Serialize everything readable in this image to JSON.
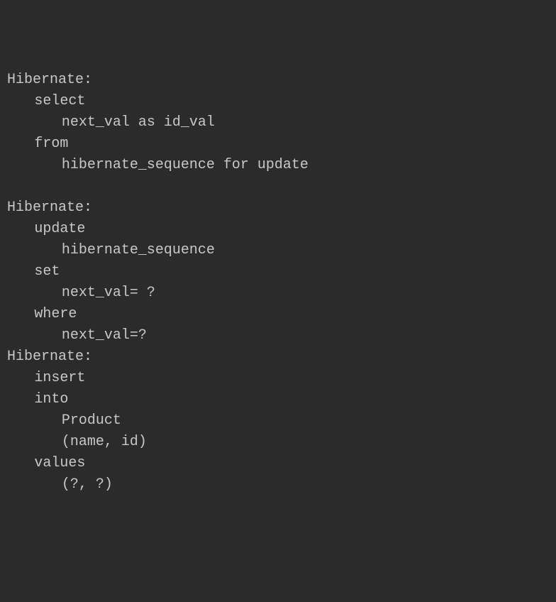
{
  "lines": [
    {
      "level": 0,
      "text": "Hibernate: "
    },
    {
      "level": 1,
      "text": "select"
    },
    {
      "level": 2,
      "text": "next_val as id_val "
    },
    {
      "level": 1,
      "text": "from"
    },
    {
      "level": 2,
      "text": "hibernate_sequence for update"
    },
    {
      "level": 0,
      "text": "            "
    },
    {
      "level": 0,
      "text": "Hibernate: "
    },
    {
      "level": 1,
      "text": "update"
    },
    {
      "level": 2,
      "text": "hibernate_sequence "
    },
    {
      "level": 1,
      "text": "set"
    },
    {
      "level": 2,
      "text": "next_val= ? "
    },
    {
      "level": 1,
      "text": "where"
    },
    {
      "level": 2,
      "text": "next_val=?"
    },
    {
      "level": 0,
      "text": "Hibernate: "
    },
    {
      "level": 1,
      "text": "insert "
    },
    {
      "level": 1,
      "text": "into"
    },
    {
      "level": 2,
      "text": "Product"
    },
    {
      "level": 2,
      "text": "(name, id) "
    },
    {
      "level": 1,
      "text": "values"
    },
    {
      "level": 2,
      "text": "(?, ?)"
    }
  ]
}
